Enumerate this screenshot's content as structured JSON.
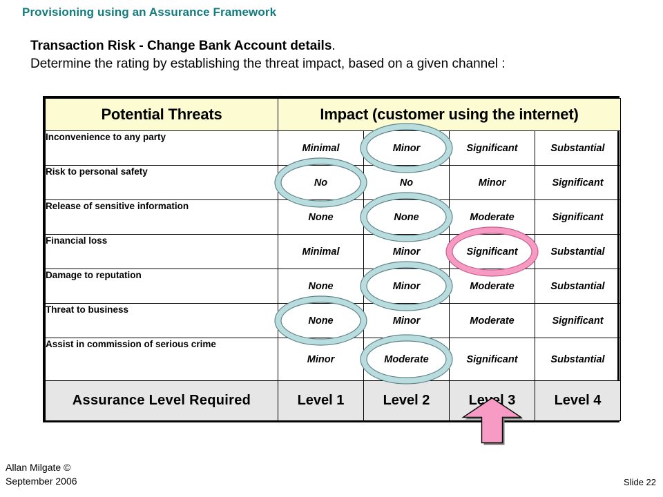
{
  "slide": {
    "title": "Provisioning using an Assurance Framework",
    "intro_bold": "Transaction Risk - Change Bank Account details",
    "intro_bold_tail": ".",
    "intro_line2": "Determine the rating by establishing the threat impact, based on a given channel :",
    "footer_author": "Allan Milgate ©",
    "footer_date": "September 2006",
    "footer_slide": "Slide 22"
  },
  "colors": {
    "title_teal": "#127B7F",
    "header_yellow": "#FCFBD2",
    "assurance_gray": "#E6E6E6",
    "ellipse_blue": "#B9DCDF",
    "ellipse_blue_outline": "#5F8487",
    "ellipse_pink": "#F79AC4",
    "ellipse_pink_outline": "#C2628C",
    "arrow_pink": "#F79AC4",
    "arrow_outline": "#000000"
  },
  "table": {
    "headers": {
      "threats": "Potential Threats",
      "impact": "Impact (customer using the internet)"
    },
    "rows": [
      {
        "threat": "Inconvenience to any party",
        "values": [
          "Minimal",
          "Minor",
          "Significant",
          "Substantial"
        ],
        "highlight": {
          "column": 1,
          "style": "blue"
        }
      },
      {
        "threat": "Risk to personal safety",
        "values": [
          "No",
          "No",
          "Minor",
          "Significant"
        ],
        "highlight": {
          "column": 0,
          "style": "blue"
        }
      },
      {
        "threat": "Release of sensitive information",
        "values": [
          "None",
          "None",
          "Moderate",
          "Significant"
        ],
        "highlight": {
          "column": 1,
          "style": "blue"
        }
      },
      {
        "threat": "Financial loss",
        "values": [
          "Minimal",
          "Minor",
          "Significant",
          "Substantial"
        ],
        "highlight": {
          "column": 2,
          "style": "pink"
        }
      },
      {
        "threat": "Damage to reputation",
        "values": [
          "None",
          "Minor",
          "Moderate",
          "Substantial"
        ],
        "highlight": {
          "column": 1,
          "style": "blue"
        }
      },
      {
        "threat": "Threat to business",
        "values": [
          "None",
          "Minor",
          "Moderate",
          "Significant"
        ],
        "highlight": {
          "column": 0,
          "style": "blue"
        }
      },
      {
        "threat": "Assist in commission of serious crime",
        "values": [
          "Minor",
          "Moderate",
          "Significant",
          "Substantial"
        ],
        "highlight": {
          "column": 1,
          "style": "blue"
        }
      }
    ],
    "assurance": {
      "label": "Assurance Level Required",
      "levels": [
        "Level 1",
        "Level 2",
        "Level 3",
        "Level 4"
      ],
      "pointer_to": "Level 3"
    }
  }
}
